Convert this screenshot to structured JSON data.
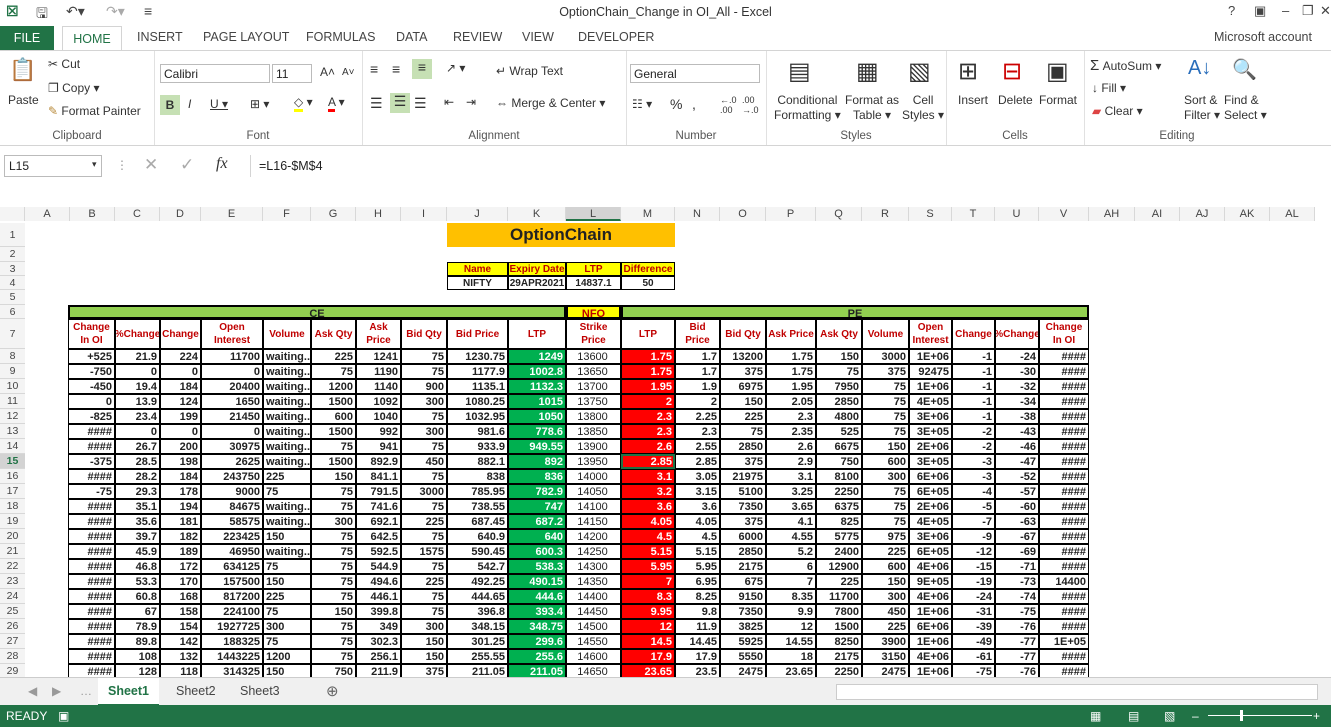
{
  "window": {
    "title": "OptionChain_Change in OI_All - Excel"
  },
  "ribbon_tabs": [
    "FILE",
    "HOME",
    "INSERT",
    "PAGE LAYOUT",
    "FORMULAS",
    "DATA",
    "REVIEW",
    "VIEW",
    "DEVELOPER"
  ],
  "account": "Microsoft account",
  "clipboard": {
    "paste": "Paste",
    "cut": "Cut",
    "copy": "Copy",
    "format_painter": "Format Painter",
    "label": "Clipboard"
  },
  "font": {
    "name": "Calibri",
    "size": "11",
    "label": "Font"
  },
  "alignment": {
    "wrap": "Wrap Text",
    "merge": "Merge & Center",
    "label": "Alignment"
  },
  "number": {
    "format": "General",
    "label": "Number"
  },
  "styles": {
    "cond1": "Conditional",
    "cond2": "Formatting",
    "fmt1": "Format as",
    "fmt2": "Table",
    "cell1": "Cell",
    "cell2": "Styles",
    "label": "Styles"
  },
  "cells": {
    "insert": "Insert",
    "delete": "Delete",
    "format": "Format",
    "label": "Cells"
  },
  "editing": {
    "autosum": "AutoSum",
    "fill": "Fill",
    "clear": "Clear",
    "sort1": "Sort &",
    "sort2": "Filter",
    "find1": "Find &",
    "find2": "Select",
    "label": "Editing"
  },
  "formula_bar": {
    "name_box": "L15",
    "formula": "=L16-$M$4"
  },
  "columns": [
    "A",
    "B",
    "C",
    "D",
    "E",
    "F",
    "G",
    "H",
    "I",
    "J",
    "K",
    "L",
    "M",
    "N",
    "O",
    "P",
    "Q",
    "R",
    "S",
    "T",
    "U",
    "V",
    "AH",
    "AI",
    "AJ",
    "AK",
    "AL"
  ],
  "sheet": {
    "title": "OptionChain",
    "info_headers": [
      "Name",
      "Expiry Date",
      "LTP",
      "Difference"
    ],
    "info_values": [
      "NIFTY",
      "29APR2021",
      "14837.1",
      "50"
    ],
    "ce_label": "CE",
    "nfo_label": "NFO",
    "pe_label": "PE",
    "headers": [
      "Change In OI",
      "%Change",
      "Change",
      "Open Interest",
      "Volume",
      "Ask Qty",
      "Ask Price",
      "Bid Qty",
      "Bid Price",
      "LTP",
      "Strike Price",
      "LTP",
      "Bid Price",
      "Bid Qty",
      "Ask Price",
      "Ask Qty",
      "Volume",
      "Open Interest",
      "Change",
      "%Change",
      "Change In OI"
    ],
    "rows": [
      [
        "+525",
        "21.9",
        "224",
        "11700",
        "waiting..",
        "225",
        "1241",
        "75",
        "1230.75",
        "1249",
        "13600",
        "1.75",
        "1.7",
        "13200",
        "1.75",
        "150",
        "3000",
        "1E+06",
        "-1",
        "-24",
        "####"
      ],
      [
        "-750",
        "0",
        "0",
        "0",
        "waiting..",
        "75",
        "1190",
        "75",
        "1177.9",
        "1002.8",
        "13650",
        "1.75",
        "1.7",
        "375",
        "1.75",
        "75",
        "375",
        "92475",
        "-1",
        "-30",
        "####"
      ],
      [
        "-450",
        "19.4",
        "184",
        "20400",
        "waiting..",
        "1200",
        "1140",
        "900",
        "1135.1",
        "1132.3",
        "13700",
        "1.95",
        "1.9",
        "6975",
        "1.95",
        "7950",
        "75",
        "1E+06",
        "-1",
        "-32",
        "####"
      ],
      [
        "0",
        "13.9",
        "124",
        "1650",
        "waiting..",
        "1500",
        "1092",
        "300",
        "1080.25",
        "1015",
        "13750",
        "2",
        "2",
        "150",
        "2.05",
        "2850",
        "75",
        "4E+05",
        "-1",
        "-34",
        "####"
      ],
      [
        "-825",
        "23.4",
        "199",
        "21450",
        "waiting..",
        "600",
        "1040",
        "75",
        "1032.95",
        "1050",
        "13800",
        "2.3",
        "2.25",
        "225",
        "2.3",
        "4800",
        "75",
        "3E+06",
        "-1",
        "-38",
        "####"
      ],
      [
        "####",
        "0",
        "0",
        "0",
        "waiting..",
        "1500",
        "992",
        "300",
        "981.6",
        "778.6",
        "13850",
        "2.3",
        "2.3",
        "75",
        "2.35",
        "525",
        "75",
        "3E+05",
        "-2",
        "-43",
        "####"
      ],
      [
        "####",
        "26.7",
        "200",
        "30975",
        "waiting..",
        "75",
        "941",
        "75",
        "933.9",
        "949.55",
        "13900",
        "2.6",
        "2.55",
        "2850",
        "2.6",
        "6675",
        "150",
        "2E+06",
        "-2",
        "-46",
        "####"
      ],
      [
        "-375",
        "28.5",
        "198",
        "2625",
        "waiting..",
        "1500",
        "892.9",
        "450",
        "882.1",
        "892",
        "13950",
        "2.85",
        "2.85",
        "375",
        "2.9",
        "750",
        "600",
        "3E+05",
        "-3",
        "-47",
        "####"
      ],
      [
        "####",
        "28.2",
        "184",
        "243750",
        "225",
        "150",
        "841.1",
        "75",
        "838",
        "836",
        "14000",
        "3.1",
        "3.05",
        "21975",
        "3.1",
        "8100",
        "300",
        "6E+06",
        "-3",
        "-52",
        "####"
      ],
      [
        "-75",
        "29.3",
        "178",
        "9000",
        "75",
        "75",
        "791.5",
        "3000",
        "785.95",
        "782.9",
        "14050",
        "3.2",
        "3.15",
        "5100",
        "3.25",
        "2250",
        "75",
        "6E+05",
        "-4",
        "-57",
        "####"
      ],
      [
        "####",
        "35.1",
        "194",
        "84675",
        "waiting..",
        "75",
        "741.6",
        "75",
        "738.55",
        "747",
        "14100",
        "3.6",
        "3.6",
        "7350",
        "3.65",
        "6375",
        "75",
        "2E+06",
        "-5",
        "-60",
        "####"
      ],
      [
        "####",
        "35.6",
        "181",
        "58575",
        "waiting..",
        "300",
        "692.1",
        "225",
        "687.45",
        "687.2",
        "14150",
        "4.05",
        "4.05",
        "375",
        "4.1",
        "825",
        "75",
        "4E+05",
        "-7",
        "-63",
        "####"
      ],
      [
        "####",
        "39.7",
        "182",
        "223425",
        "150",
        "75",
        "642.5",
        "75",
        "640.9",
        "640",
        "14200",
        "4.5",
        "4.5",
        "6000",
        "4.55",
        "5775",
        "975",
        "3E+06",
        "-9",
        "-67",
        "####"
      ],
      [
        "####",
        "45.9",
        "189",
        "46950",
        "waiting..",
        "75",
        "592.5",
        "1575",
        "590.45",
        "600.3",
        "14250",
        "5.15",
        "5.15",
        "2850",
        "5.2",
        "2400",
        "225",
        "6E+05",
        "-12",
        "-69",
        "####"
      ],
      [
        "####",
        "46.8",
        "172",
        "634125",
        "75",
        "75",
        "544.9",
        "75",
        "542.7",
        "538.3",
        "14300",
        "5.95",
        "5.95",
        "2175",
        "6",
        "12900",
        "600",
        "4E+06",
        "-15",
        "-71",
        "####"
      ],
      [
        "####",
        "53.3",
        "170",
        "157500",
        "150",
        "75",
        "494.6",
        "225",
        "492.25",
        "490.15",
        "14350",
        "7",
        "6.95",
        "675",
        "7",
        "225",
        "150",
        "9E+05",
        "-19",
        "-73",
        "14400"
      ],
      [
        "####",
        "60.8",
        "168",
        "817200",
        "225",
        "75",
        "446.1",
        "75",
        "444.65",
        "444.6",
        "14400",
        "8.3",
        "8.25",
        "9150",
        "8.35",
        "11700",
        "300",
        "4E+06",
        "-24",
        "-74",
        "####"
      ],
      [
        "####",
        "67",
        "158",
        "224100",
        "75",
        "150",
        "399.8",
        "75",
        "396.8",
        "393.4",
        "14450",
        "9.95",
        "9.8",
        "7350",
        "9.9",
        "7800",
        "450",
        "1E+06",
        "-31",
        "-75",
        "####"
      ],
      [
        "####",
        "78.9",
        "154",
        "1927725",
        "300",
        "75",
        "349",
        "300",
        "348.15",
        "348.75",
        "14500",
        "12",
        "11.9",
        "3825",
        "12",
        "1500",
        "225",
        "6E+06",
        "-39",
        "-76",
        "####"
      ],
      [
        "####",
        "89.8",
        "142",
        "188325",
        "75",
        "75",
        "302.3",
        "150",
        "301.25",
        "299.6",
        "14550",
        "14.5",
        "14.45",
        "5925",
        "14.55",
        "8250",
        "3900",
        "1E+06",
        "-49",
        "-77",
        "1E+05"
      ],
      [
        "####",
        "108",
        "132",
        "1443225",
        "1200",
        "75",
        "256.1",
        "150",
        "255.55",
        "255.6",
        "14600",
        "17.9",
        "17.9",
        "5550",
        "18",
        "2175",
        "3150",
        "4E+06",
        "-61",
        "-77",
        "####"
      ],
      [
        "####",
        "128",
        "118",
        "314325",
        "150",
        "750",
        "211.9",
        "375",
        "211.05",
        "211.05",
        "14650",
        "23.65",
        "23.5",
        "2475",
        "23.65",
        "2250",
        "2475",
        "1E+06",
        "-75",
        "-76",
        "####"
      ]
    ]
  },
  "sheet_tabs": [
    "Sheet1",
    "Sheet2",
    "Sheet3"
  ],
  "status": "READY",
  "colors": {
    "excel_green": "#217346",
    "title_fill": "#ffc000",
    "yellow": "#ffff00",
    "header_green": "#92d050",
    "ltp_green": "#00b050",
    "ltp_red": "#ff0000",
    "header_text_red": "#c00000"
  }
}
